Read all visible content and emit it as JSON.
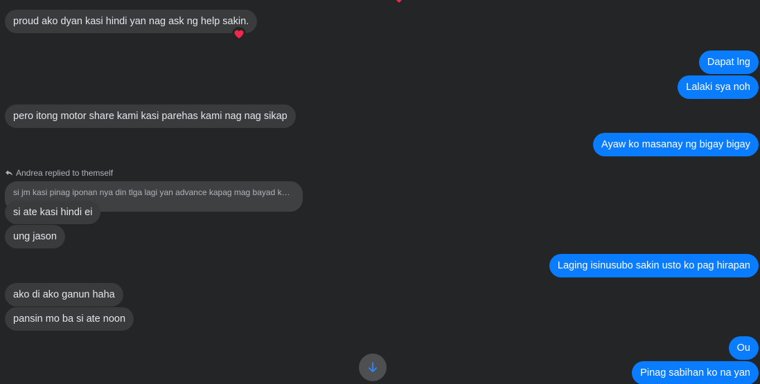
{
  "conversation": {
    "reply_label": "Andrea replied to themself",
    "quoted_message": "si jm kasi pinag iponan nya din tlga lagi yan advance kapag mag bayad ka…",
    "messages": [
      {
        "sender": "them",
        "text": "proud ako dyan kasi hindi yan nag ask ng help sakin.",
        "reaction": "heart-icon"
      },
      {
        "sender": "me",
        "text": "Dapat lng"
      },
      {
        "sender": "me",
        "text": "Lalaki sya noh"
      },
      {
        "sender": "them",
        "text": "pero itong motor share kami kasi parehas kami nag nag sikap"
      },
      {
        "sender": "me",
        "text": "Ayaw ko masanay ng bigay bigay"
      },
      {
        "sender": "them",
        "text": "si ate kasi hindi ei"
      },
      {
        "sender": "them",
        "text": "ung jason"
      },
      {
        "sender": "me",
        "text": "Laging isinusubo sakin usto ko pag hirapan"
      },
      {
        "sender": "them",
        "text": "ako di ako ganun haha"
      },
      {
        "sender": "them",
        "text": "pansin mo ba si ate noon"
      },
      {
        "sender": "me",
        "text": "Ou"
      },
      {
        "sender": "me",
        "text": "Pinag sabihan ko na yan"
      }
    ]
  },
  "colors": {
    "background": "#242526",
    "incoming_bubble": "#3a3b3c",
    "outgoing_bubble": "#0a7cff",
    "quoted_bubble": "#3e4042",
    "reaction_heart": "#f02849",
    "scroll_button": "#4e4f50",
    "scroll_arrow": "#2d88ff"
  },
  "icons": {
    "reply": "reply-arrow-icon",
    "reaction": "heart-icon",
    "scroll": "arrow-down-icon"
  }
}
